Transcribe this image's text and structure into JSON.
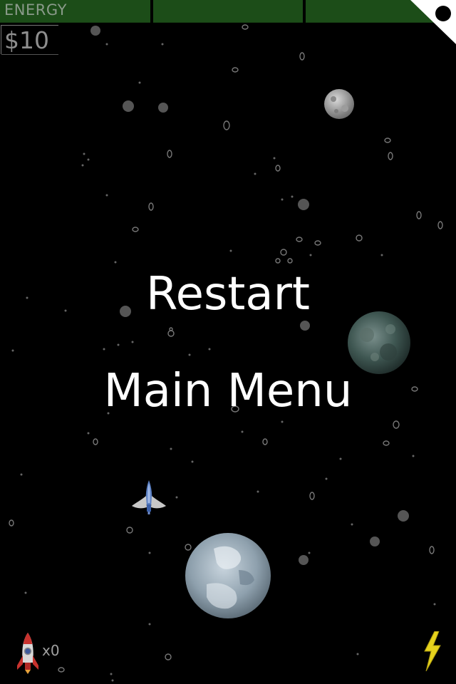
{
  "hud": {
    "energy_label": "ENERGY",
    "money_label": "$10",
    "rocket_count": "x0",
    "colors": {
      "energy_bar": "#1c4d18",
      "hud_text": "#8e8e8e"
    }
  },
  "menu": {
    "restart_label": "Restart",
    "main_menu_label": "Main Menu"
  },
  "icons": {
    "corner": "pause-dot-icon",
    "ship": "spaceship-icon",
    "rocket": "rocket-icon",
    "bolt": "lightning-bolt-icon"
  }
}
